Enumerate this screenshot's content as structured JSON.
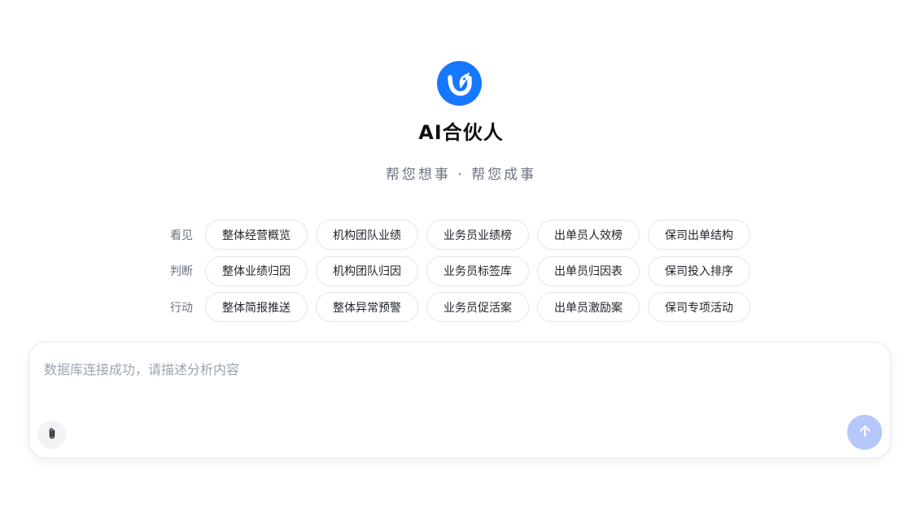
{
  "brand": {
    "logo_icon": "bird-logo-icon",
    "logo_color": "#1677ff",
    "title": "AI合伙人",
    "subtitle": "帮您想事 · 帮您成事"
  },
  "suggestions": [
    {
      "label": "看见",
      "items": [
        "整体经营概览",
        "机构团队业绩",
        "业务员业绩榜",
        "出单员人效榜",
        "保司出单结构"
      ]
    },
    {
      "label": "判断",
      "items": [
        "整体业绩归因",
        "机构团队归因",
        "业务员标签库",
        "出单员归因表",
        "保司投入排序"
      ]
    },
    {
      "label": "行动",
      "items": [
        "整体简报推送",
        "整体异常预警",
        "业务员促活案",
        "出单员激励案",
        "保司专项活动"
      ]
    }
  ],
  "composer": {
    "value": "",
    "placeholder": "数据库连接成功，请描述分析内容",
    "attach_icon": "paperclip-icon",
    "send_icon": "arrow-up-icon",
    "send_color": "#b5c8f9"
  }
}
